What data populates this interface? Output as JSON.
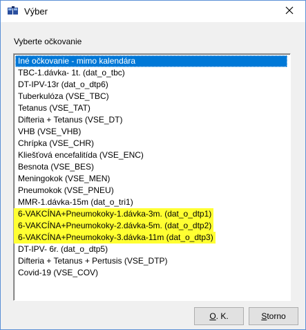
{
  "window": {
    "title": "Výber"
  },
  "prompt": "Vyberte očkovanie",
  "list": {
    "items": [
      {
        "label": "Iné očkovanie - mimo kalendára",
        "selected": true,
        "highlighted": false
      },
      {
        "label": "TBC-1.dávka- 1t.  (dat_o_tbc)",
        "selected": false,
        "highlighted": false
      },
      {
        "label": "DT-IPV-13r  (dat_o_dtp6)",
        "selected": false,
        "highlighted": false
      },
      {
        "label": "Tuberkulóza  (VSE_TBC)",
        "selected": false,
        "highlighted": false
      },
      {
        "label": "Tetanus  (VSE_TAT)",
        "selected": false,
        "highlighted": false
      },
      {
        "label": "Difteria + Tetanus  (VSE_DT)",
        "selected": false,
        "highlighted": false
      },
      {
        "label": "VHB  (VSE_VHB)",
        "selected": false,
        "highlighted": false
      },
      {
        "label": "Chrípka  (VSE_CHR)",
        "selected": false,
        "highlighted": false
      },
      {
        "label": "Kliešťová encefalitída  (VSE_ENC)",
        "selected": false,
        "highlighted": false
      },
      {
        "label": "Besnota  (VSE_BES)",
        "selected": false,
        "highlighted": false
      },
      {
        "label": "Meningokok  (VSE_MEN)",
        "selected": false,
        "highlighted": false
      },
      {
        "label": "Pneumokok  (VSE_PNEU)",
        "selected": false,
        "highlighted": false
      },
      {
        "label": "MMR-1.dávka-15m  (dat_o_tri1)",
        "selected": false,
        "highlighted": false
      },
      {
        "label": "6-VAKCÍNA+Pneumokoky-1.dávka-3m.  (dat_o_dtp1)",
        "selected": false,
        "highlighted": true
      },
      {
        "label": "6-VAKCÍNA+Pneumokoky-2.dávka-5m.  (dat_o_dtp2)",
        "selected": false,
        "highlighted": true
      },
      {
        "label": "6-VAKCÍNA+Pneumokoky-3.dávka-11m  (dat_o_dtp3)",
        "selected": false,
        "highlighted": true
      },
      {
        "label": "DT-IPV- 6r.  (dat_o_dtp5)",
        "selected": false,
        "highlighted": false
      },
      {
        "label": "Difteria + Tetanus + Pertusis  (VSE_DTP)",
        "selected": false,
        "highlighted": false
      },
      {
        "label": "Covid-19  (VSE_COV)",
        "selected": false,
        "highlighted": false
      }
    ]
  },
  "buttons": {
    "ok_accel": "O",
    "ok_rest": ". K.",
    "cancel_accel": "S",
    "cancel_rest": "torno"
  },
  "colors": {
    "selection": "#0078d7",
    "marker_highlight": "#ffff32"
  },
  "icons": {
    "app": "app-icon",
    "close": "close-icon"
  }
}
